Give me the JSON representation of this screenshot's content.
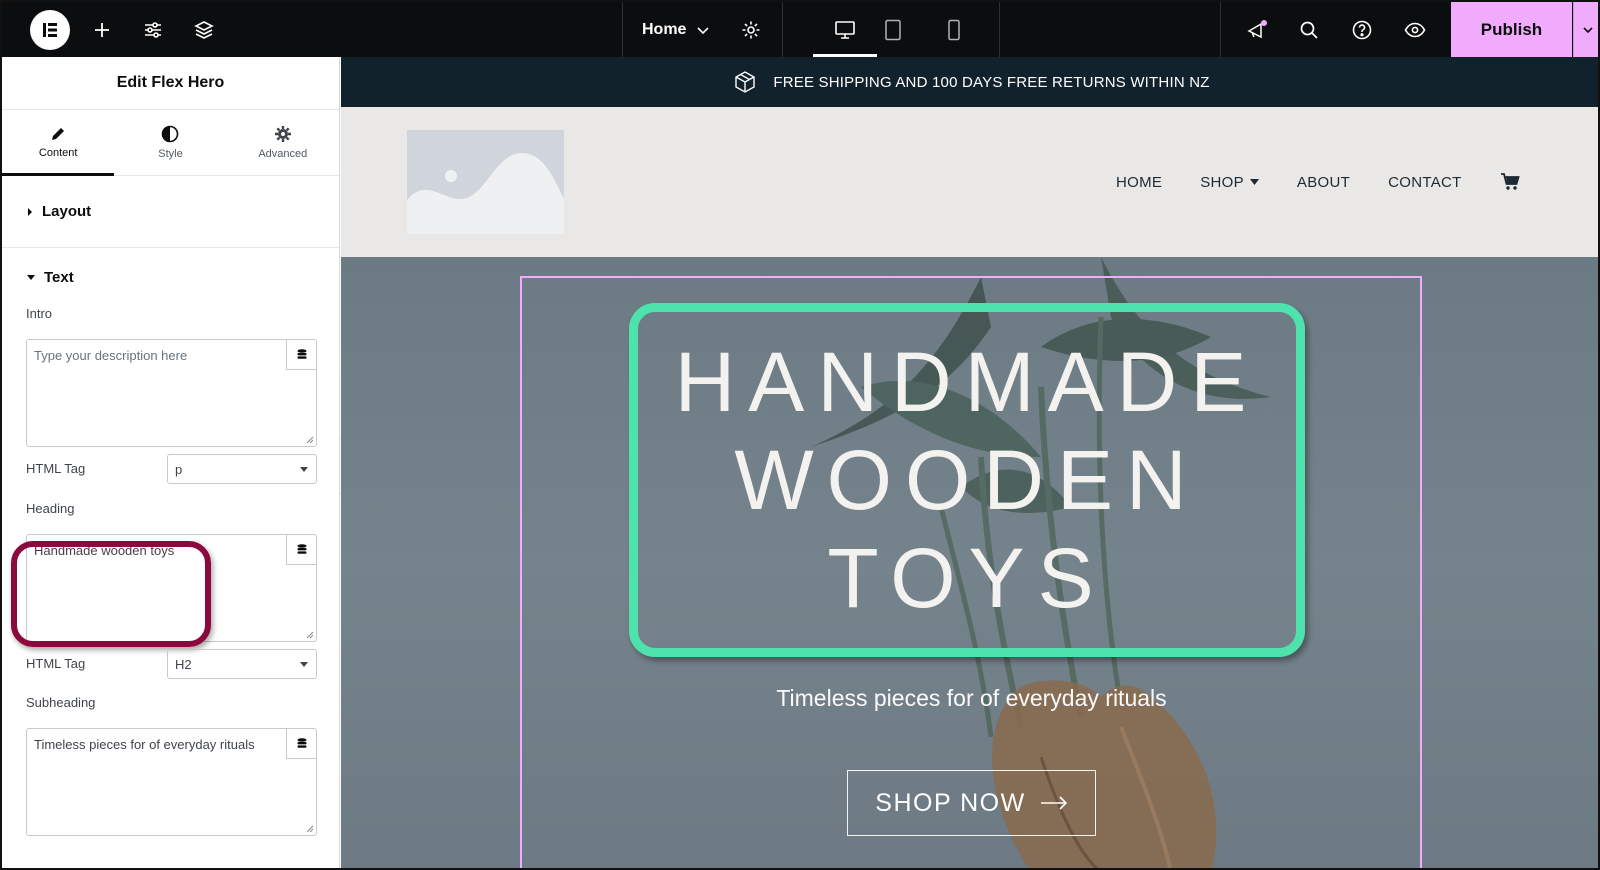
{
  "topbar": {
    "page_name": "Home",
    "publish_label": "Publish",
    "icons": [
      "elementor-logo-icon",
      "add-icon",
      "settings-sliders-icon",
      "layers-icon",
      "chevron-down-icon",
      "gear-icon",
      "desktop-icon",
      "tablet-icon",
      "mobile-icon",
      "megaphone-icon",
      "search-icon",
      "help-icon",
      "eye-icon"
    ],
    "accent_color": "#f0abfc"
  },
  "panel": {
    "title": "Edit Flex Hero",
    "tabs": [
      {
        "label": "Content",
        "icon": "pencil-icon",
        "active": true
      },
      {
        "label": "Style",
        "icon": "half-circle-icon",
        "active": false
      },
      {
        "label": "Advanced",
        "icon": "gear-icon",
        "active": false
      }
    ],
    "sections": {
      "layout": "Layout",
      "text": "Text"
    },
    "fields": {
      "intro_label": "Intro",
      "intro_placeholder": "Type your description here",
      "intro_tag_label": "HTML Tag",
      "intro_tag_value": "p",
      "heading_label": "Heading",
      "heading_value": "Handmade wooden toys",
      "heading_tag_label": "HTML Tag",
      "heading_tag_value": "H2",
      "subheading_label": "Subheading",
      "subheading_value": "Timeless pieces for of everyday rituals"
    },
    "highlight_color": "#8b0a3e"
  },
  "site": {
    "announcement": "FREE SHIPPING AND 100 DAYS FREE RETURNS WITHIN NZ",
    "nav": [
      "HOME",
      "SHOP",
      "ABOUT",
      "CONTACT"
    ],
    "hero_heading": "Handmade wooden toys",
    "hero_subheading": "Timeless pieces for of everyday rituals",
    "cta_label": "SHOP NOW",
    "heading_box_color": "#4ee2ad"
  }
}
